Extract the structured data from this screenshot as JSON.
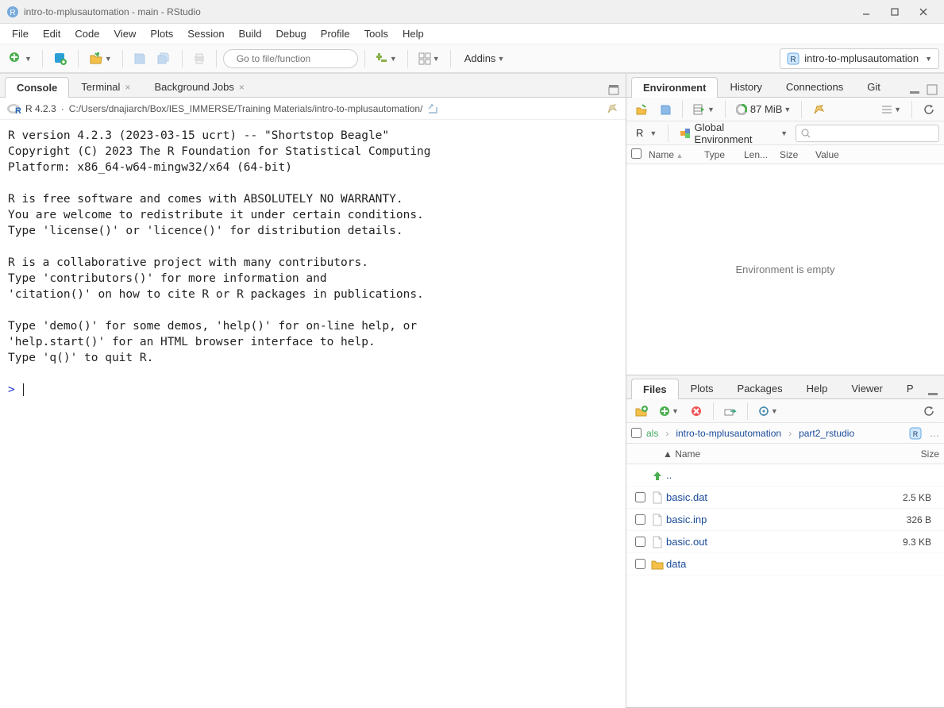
{
  "window": {
    "title": "intro-to-mplusautomation - main - RStudio"
  },
  "menubar": [
    "File",
    "Edit",
    "Code",
    "View",
    "Plots",
    "Session",
    "Build",
    "Debug",
    "Profile",
    "Tools",
    "Help"
  ],
  "toolbar": {
    "goto_placeholder": "Go to file/function",
    "addins_label": "Addins",
    "project_name": "intro-to-mplusautomation"
  },
  "left": {
    "tabs": [
      {
        "label": "Console",
        "active": true,
        "closable": false
      },
      {
        "label": "Terminal",
        "active": false,
        "closable": true
      },
      {
        "label": "Background Jobs",
        "active": false,
        "closable": true
      }
    ],
    "console": {
      "r_version": "R 4.2.3",
      "path": "C:/Users/dnajiarch/Box/IES_IMMERSE/Training Materials/intro-to-mplusautomation/",
      "startup_text": "R version 4.2.3 (2023-03-15 ucrt) -- \"Shortstop Beagle\"\nCopyright (C) 2023 The R Foundation for Statistical Computing\nPlatform: x86_64-w64-mingw32/x64 (64-bit)\n\nR is free software and comes with ABSOLUTELY NO WARRANTY.\nYou are welcome to redistribute it under certain conditions.\nType 'license()' or 'licence()' for distribution details.\n\nR is a collaborative project with many contributors.\nType 'contributors()' for more information and\n'citation()' on how to cite R or R packages in publications.\n\nType 'demo()' for some demos, 'help()' for on-line help, or\n'help.start()' for an HTML browser interface to help.\nType 'q()' to quit R.\n",
      "prompt": ">"
    }
  },
  "env_pane": {
    "tabs": [
      {
        "label": "Environment",
        "active": true
      },
      {
        "label": "History",
        "active": false
      },
      {
        "label": "Connections",
        "active": false
      },
      {
        "label": "Git",
        "active": false
      }
    ],
    "memory": "87 MiB",
    "scope_lang": "R",
    "scope_env": "Global Environment",
    "columns": [
      "Name",
      "Type",
      "Len...",
      "Size",
      "Value"
    ],
    "empty_text": "Environment is empty"
  },
  "files_pane": {
    "tabs": [
      {
        "label": "Files",
        "active": true
      },
      {
        "label": "Plots",
        "active": false
      },
      {
        "label": "Packages",
        "active": false
      },
      {
        "label": "Help",
        "active": false
      },
      {
        "label": "Viewer",
        "active": false
      },
      {
        "label": "P",
        "active": false
      }
    ],
    "breadcrumb": [
      "als",
      "intro-to-mplusautomation",
      "part2_rstudio"
    ],
    "columns": {
      "name": "Name",
      "size": "Size"
    },
    "up_label": "..",
    "files": [
      {
        "name": "basic.dat",
        "size": "2.5 KB",
        "kind": "file"
      },
      {
        "name": "basic.inp",
        "size": "326 B",
        "kind": "file"
      },
      {
        "name": "basic.out",
        "size": "9.3 KB",
        "kind": "file"
      },
      {
        "name": "data",
        "size": "",
        "kind": "folder"
      }
    ]
  }
}
